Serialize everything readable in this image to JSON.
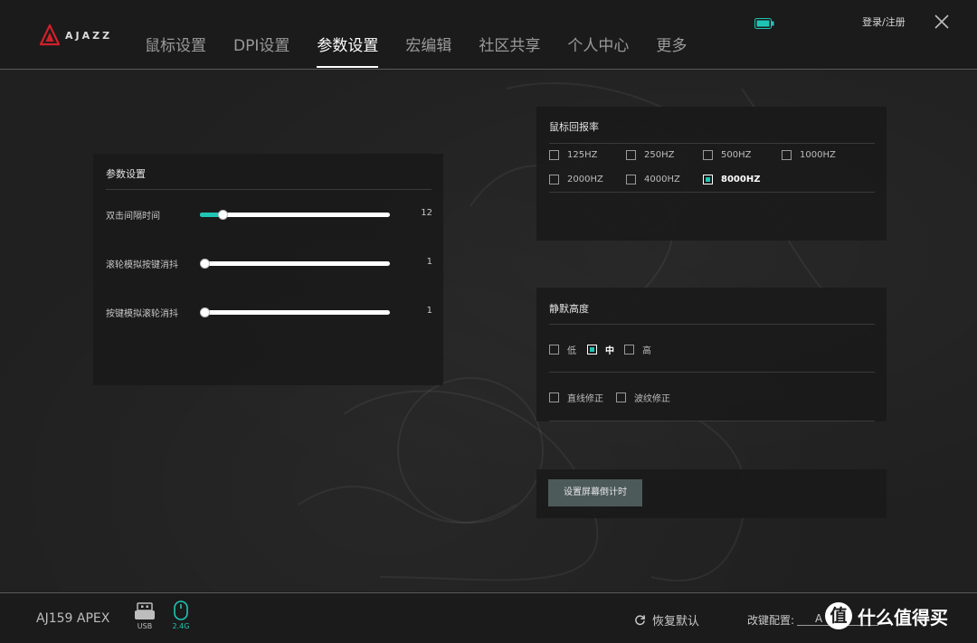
{
  "brand": {
    "name": "AJAZZ"
  },
  "nav": {
    "items": [
      "鼠标设置",
      "DPI设置",
      "参数设置",
      "宏编辑",
      "社区共享",
      "个人中心",
      "更多"
    ],
    "active_index": 2
  },
  "header": {
    "login_label": "登录/注册",
    "battery_icon": "battery-icon",
    "close_icon": "close-icon"
  },
  "params_panel": {
    "title": "参数设置",
    "sliders": [
      {
        "label": "双击间隔时间",
        "value": "12",
        "fraction": 0.05
      },
      {
        "label": "滚轮模拟按键消抖",
        "value": "1",
        "fraction": 0.0
      },
      {
        "label": "按键模拟滚轮消抖",
        "value": "1",
        "fraction": 0.0
      }
    ]
  },
  "polling_panel": {
    "title": "鼠标回报率",
    "options": [
      {
        "label": "125HZ",
        "checked": false
      },
      {
        "label": "250HZ",
        "checked": false
      },
      {
        "label": "500HZ",
        "checked": false
      },
      {
        "label": "1000HZ",
        "checked": false
      },
      {
        "label": "2000HZ",
        "checked": false
      },
      {
        "label": "4000HZ",
        "checked": false
      },
      {
        "label": "8000HZ",
        "checked": true
      }
    ]
  },
  "lod_panel": {
    "title": "静默高度",
    "options": [
      {
        "label": "低",
        "checked": false
      },
      {
        "label": "中",
        "checked": true
      },
      {
        "label": "高",
        "checked": false
      }
    ],
    "corrections": [
      {
        "label": "直线修正",
        "checked": false
      },
      {
        "label": "波纹修正",
        "checked": false
      }
    ]
  },
  "timer_button": {
    "label": "设置屏幕倒计时"
  },
  "footer": {
    "model": "AJ159 APEX",
    "connections": [
      {
        "label": "USB",
        "icon": "usb-icon",
        "active": false
      },
      {
        "label": "2.4G",
        "icon": "mouse-icon",
        "active": true
      }
    ],
    "reset_label": "恢复默认",
    "config_label": "改键配置:",
    "config_value": "A",
    "watermark": "什么值得买"
  },
  "colors": {
    "accent": "#1fc5b4",
    "background": "#1f1f1f",
    "panel": "#1a1a1a"
  }
}
